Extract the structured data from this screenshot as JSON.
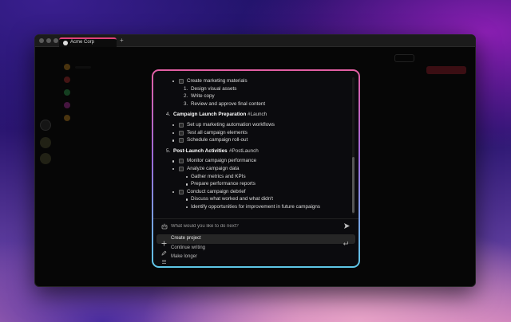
{
  "tab": {
    "title": "Acme Corp",
    "add": "+"
  },
  "document": {
    "rows": [
      {
        "type": "check",
        "level": 1,
        "text": "Create marketing materials"
      },
      {
        "type": "num",
        "level": 2,
        "num": "1.",
        "text": "Design visual assets"
      },
      {
        "type": "num",
        "level": 2,
        "num": "2.",
        "text": "Write copy"
      },
      {
        "type": "num",
        "level": 2,
        "num": "3.",
        "text": "Review and approve final content"
      },
      {
        "type": "heading",
        "num": "4.",
        "text": "Campaign Launch Preparation",
        "tag": "#Launch"
      },
      {
        "type": "check",
        "level": 1,
        "text": "Set up marketing automation workflows"
      },
      {
        "type": "check",
        "level": 1,
        "text": "Test all campaign elements"
      },
      {
        "type": "check",
        "level": 1,
        "text": "Schedule campaign roll-out"
      },
      {
        "type": "heading",
        "num": "5.",
        "text": "Post-Launch Activities",
        "tag": "#PostLaunch"
      },
      {
        "type": "check",
        "level": 1,
        "text": "Monitor campaign performance"
      },
      {
        "type": "check",
        "level": 1,
        "text": "Analyze campaign data"
      },
      {
        "type": "bullet",
        "level": 2,
        "text": "Gather metrics and KPIs"
      },
      {
        "type": "bullet",
        "level": 2,
        "text": "Prepare performance reports"
      },
      {
        "type": "check",
        "level": 1,
        "text": "Conduct campaign debrief"
      },
      {
        "type": "bullet",
        "level": 2,
        "text": "Discuss what worked and what didn't"
      },
      {
        "type": "bullet",
        "level": 2,
        "text": "Identify opportunities for improvement in future campaigns"
      }
    ]
  },
  "prompt": {
    "placeholder": "What would you like to do next?"
  },
  "menu": [
    {
      "label": "Create project",
      "icon": "plus-icon",
      "active": true
    },
    {
      "label": "Continue writing",
      "icon": "pencil-icon",
      "active": false
    },
    {
      "label": "Make longer",
      "icon": "lines-icon",
      "active": false
    }
  ],
  "colors": {
    "accent": "#e0407a",
    "modal_border_top": "#e35fa3",
    "modal_border_bottom": "#5ec6e6"
  }
}
